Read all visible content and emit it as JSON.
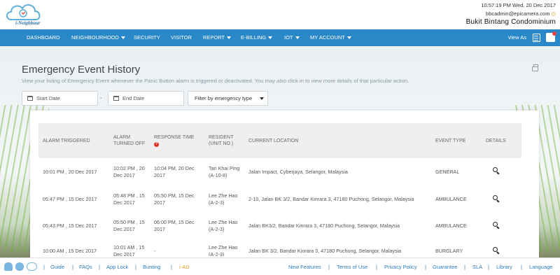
{
  "header": {
    "app_name": "i-Neighbour",
    "datetime": "10:57:19 PM  Wed, 20 Dec 2017",
    "user": "bbcadmin@epicamera.com",
    "condo": "Bukit Bintang Condominium"
  },
  "nav": {
    "items": [
      {
        "label": "DASHBOARD",
        "dropdown": false
      },
      {
        "label": "NEIGHBOURHOOD",
        "dropdown": true
      },
      {
        "label": "SECURITY",
        "dropdown": false
      },
      {
        "label": "VISITOR",
        "dropdown": false
      },
      {
        "label": "REPORT",
        "dropdown": true
      },
      {
        "label": "E-BILLING",
        "dropdown": true
      },
      {
        "label": "IOT",
        "dropdown": true
      },
      {
        "label": "MY ACCOUNT",
        "dropdown": true
      }
    ],
    "view_as": "View As"
  },
  "page": {
    "title": "Emergency Event History",
    "description": "View your listing of Emergency Event whenever the Panic Button alarm is triggered or deactivated. You may also click in to view more details of that particular action."
  },
  "filters": {
    "start_placeholder": "Start Date",
    "end_placeholder": "End Date",
    "separator": "-",
    "type_label": "Filter by emergency type"
  },
  "table": {
    "headers": {
      "alarm_triggered": "ALARM TRIGGERED",
      "alarm_turned_off": "ALARM TURNED OFF",
      "response_time": "RESPONSE TIME",
      "resident": "RESIDENT (UNIT NO.)",
      "location": "CURRENT LOCATION",
      "event_type": "EVENT TYPE",
      "details": "DETAILS"
    },
    "rows": [
      {
        "triggered": "10:01 PM , 20 Dec 2017",
        "off": "10:02 PM , 20 Dec 2017",
        "response": "10:04 PM, 20 Dec 2017",
        "resident": "Tan Khai Ping (A-10-8)",
        "location": "Jalan Impact, Cyberjaya, Selangor, Malaysia",
        "type": "GENERAL"
      },
      {
        "triggered": "05:47 PM , 15 Dec 2017",
        "off": "05:48 PM , 15 Dec 2017",
        "response": "05:50 PM, 15 Dec 2017",
        "resident": "Lee Zhe Hao (A-2-3)",
        "location": "2-10, Jalan BK 3/2, Bandar Kinrara 3, 47180 Puchong, Selangor, Malaysia",
        "type": "AMBULANCE"
      },
      {
        "triggered": "05:43 PM , 15 Dec 2017",
        "off": "05:50 PM , 15 Dec 2017",
        "response": "06:00 PM, 15 Dec 2017",
        "resident": "Lee Zhe Hao (A-2-3)",
        "location": "Jalan BK3/2, Bandar Kinrara 3, 47180 Puchong, Selangor, Malaysia",
        "type": "AMBULANCE"
      },
      {
        "triggered": "10:00 AM , 15 Dec 2017",
        "off": "10:01 AM , 15 Dec 2017",
        "response": "-",
        "resident": "Lee Zhe Hao (A-2-3)",
        "location": "Jalan BK 3/2, Bandar Kinrara 3, 47180 Puchong, Selangor, Malaysia",
        "type": "BURGLARY"
      }
    ]
  },
  "footer": {
    "left_links": [
      "Guide",
      "FAQs",
      "App Lock",
      "Bunting",
      "i-AD"
    ],
    "right_links": [
      "New Features",
      "Terms of Use",
      "Privacy Policy",
      "Guarantee",
      "SLA",
      "Library",
      "Language"
    ]
  },
  "colors": {
    "nav_bg": "#2a87c8",
    "link": "#2a7bbd",
    "alert": "#dd3322"
  },
  "icons": [
    "logo-cloud-icon",
    "clock-icon",
    "view-list-icon",
    "notification-icon",
    "print-icon",
    "calendar-icon",
    "help-icon",
    "magnifier-icon",
    "android-icon",
    "apple-icon",
    "cloud-icon"
  ]
}
